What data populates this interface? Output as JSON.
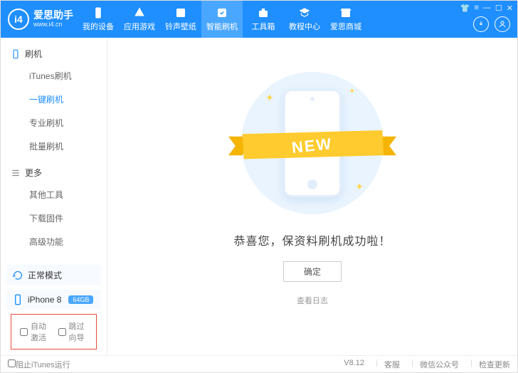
{
  "app": {
    "name": "爱思助手",
    "url": "www.i4.cn",
    "logo_short": "i4"
  },
  "nav": {
    "items": [
      {
        "label": "我的设备"
      },
      {
        "label": "应用游戏"
      },
      {
        "label": "铃声壁纸"
      },
      {
        "label": "智能刷机"
      },
      {
        "label": "工具箱"
      },
      {
        "label": "教程中心"
      },
      {
        "label": "爱思商城"
      }
    ],
    "active_index": 3
  },
  "sidebar": {
    "sections": [
      {
        "title": "刷机",
        "items": [
          "iTunes刷机",
          "一键刷机",
          "专业刷机",
          "批量刷机"
        ],
        "active_index": 1
      },
      {
        "title": "更多",
        "items": [
          "其他工具",
          "下载固件",
          "高级功能"
        ],
        "active_index": -1
      }
    ],
    "mode": "正常模式",
    "device": {
      "name": "iPhone 8",
      "storage": "64GB"
    },
    "options": {
      "auto_activate": "自动激活",
      "skip_guide": "跳过向导"
    }
  },
  "main": {
    "ribbon": "NEW",
    "success": "恭喜您，保资料刷机成功啦！",
    "ok": "确定",
    "log": "查看日志"
  },
  "footer": {
    "block_itunes": "阻止iTunes运行",
    "version": "V8.12",
    "links": [
      "客服",
      "微信公众号",
      "检查更新"
    ]
  }
}
